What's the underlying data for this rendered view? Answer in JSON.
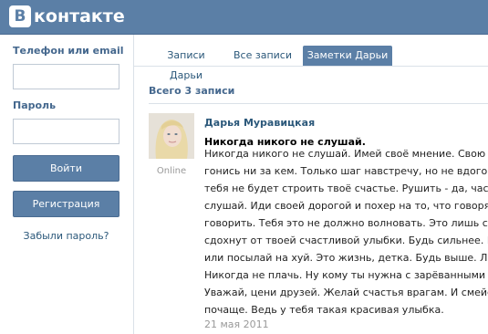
{
  "logo": {
    "letter": "В",
    "text": "контакте"
  },
  "login": {
    "phone_label": "Телефон или email",
    "password_label": "Пароль",
    "login_button": "Войти",
    "register_button": "Регистрация",
    "forgot_link": "Забыли пароль?"
  },
  "tabs": [
    {
      "label": "Записи Дарьи",
      "active": false
    },
    {
      "label": "Все записи",
      "active": false
    },
    {
      "label": "Заметки Дарьи",
      "active": true
    }
  ],
  "total": "Всего 3 записи",
  "post": {
    "author": "Дарья Муравицкая",
    "status": "Online",
    "title": "Никогда никого не слушай.",
    "lines": [
      "Никогда никого не слушай. Имей своё мнение. Свою голову. Н",
      "гонись ни за кем. Только шаг навстречу, но не вдогонку. Ты",
      "тебя не будет строить твоё счастье. Рушить - да, часто. Но",
      "слушай. Иди своей дорогой и похер на то, что говорят за спи",
      "говорить. Тебя это не должно волновать. Это лишь сплетни",
      "сдохнут от твоей счастливой улыбки. Будь сильнее. Всем, кт",
      "или посылай на хуй. Это жизнь, детка. Будь выше. Люби. Те",
      "Никогда не плачь. Ну кому ты нужна с зарёванными красным",
      "Уважай, цени друзей. Желай счастья врагам. И смейся над и",
      "почаще. Ведь у тебя такая красивая улыбка."
    ],
    "date": "21 мая 2011"
  }
}
